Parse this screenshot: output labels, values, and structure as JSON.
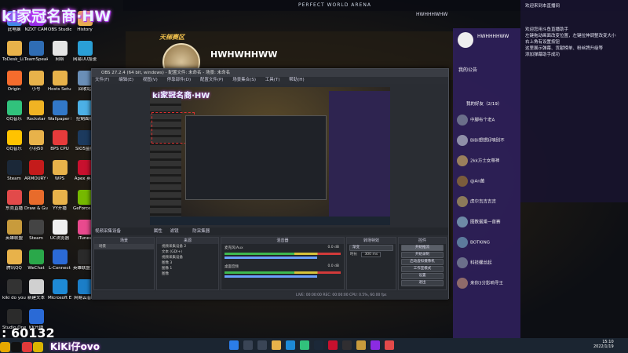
{
  "overlay": {
    "logo": "ki家冠名商·HW",
    "bottom_number": ": 60132",
    "social_handle": "KiKi仔ovo"
  },
  "desktop_icons": [
    {
      "label": "此电脑",
      "color": "#3a8ee6"
    },
    {
      "label": "NZXT CAM",
      "color": "#8b2be2"
    },
    {
      "label": "OBS Studio",
      "color": "#302e31"
    },
    {
      "label": "History",
      "color": "#e8b24a"
    },
    {
      "label": "ToDesk_Li...",
      "color": "#e8b24a"
    },
    {
      "label": "TeamSpeak 3",
      "color": "#2f6db5"
    },
    {
      "label": "网络",
      "color": "#e5e5e5"
    },
    {
      "label": "网易UU加速器",
      "color": "#2a9fd6"
    },
    {
      "label": "Origin",
      "color": "#f56c2d"
    },
    {
      "label": "小号",
      "color": "#e8b24a"
    },
    {
      "label": "Hosts Setup",
      "color": "#e8b24a"
    },
    {
      "label": "回收站",
      "color": "#6a8fb8"
    },
    {
      "label": "QQ音乐",
      "color": "#31c27c"
    },
    {
      "label": "Rockstar",
      "color": "#f0b323"
    },
    {
      "label": "Wallpaper Engine",
      "color": "#3278c8"
    },
    {
      "label": "控制面板",
      "color": "#4cb0e6"
    },
    {
      "label": "QQ音乐",
      "color": "#ffc300"
    },
    {
      "label": "小羽50",
      "color": "#e8b24a"
    },
    {
      "label": "BPS CPU",
      "color": "#e63b3b"
    },
    {
      "label": "SIO5监控",
      "color": "#1c3a5e"
    },
    {
      "label": "Steam",
      "color": "#1b2838"
    },
    {
      "label": "ARMOURY CRATE",
      "color": "#c41b1b"
    },
    {
      "label": "WPS",
      "color": "#e8b24a"
    },
    {
      "label": "Apex 英雄",
      "color": "#c8102e"
    },
    {
      "label": "东莞直播",
      "color": "#e24a4a"
    },
    {
      "label": "Draw & Guess",
      "color": "#e86b2b"
    },
    {
      "label": "YY开播",
      "color": "#e8b24a"
    },
    {
      "label": "GeForce Experience",
      "color": "#76b900"
    },
    {
      "label": "英雄联盟",
      "color": "#c89b3c"
    },
    {
      "label": "Steam",
      "color": "#444"
    },
    {
      "label": "UC浏览器",
      "color": "#f0f0f0"
    },
    {
      "label": "iTunes",
      "color": "#e94a8e"
    },
    {
      "label": "腾讯QQ",
      "color": "#e8b24a"
    },
    {
      "label": "WeChat",
      "color": "#2aa84a"
    },
    {
      "label": "L-Connect",
      "color": "#2b6ad6"
    },
    {
      "label": "英雄联盟大厅",
      "color": "#2a2a2a"
    },
    {
      "label": "kiki do you love me",
      "color": "#333"
    },
    {
      "label": "新建文本",
      "color": "#d0d0d0"
    },
    {
      "label": "Microsoft Edge",
      "color": "#1e8ad6"
    },
    {
      "label": "网易云音乐",
      "color": "#1b7ec8"
    },
    {
      "label": "Studio One 5",
      "color": "#2b2b2b"
    },
    {
      "label": "KK开播",
      "color": "#2a6ad6"
    }
  ],
  "game": {
    "title": "PERFECT WORLD ARENA",
    "user": "HWHHHWHW",
    "channel_name": "HWHWHHWW",
    "channel_logo": "天梯赛区"
  },
  "obs": {
    "title": "OBS 27.2.4 (64 bit, windows) - 配置文件: 未命名 - 场景: 未命名",
    "menu": [
      "文件(F)",
      "编辑(E)",
      "视图(V)",
      "停靠部件(D)",
      "配置文件(P)",
      "场景集合(S)",
      "工具(T)",
      "帮助(H)"
    ],
    "toolbar": {
      "source_label": "视频采集设备",
      "props": "属性",
      "filters": "滤镜",
      "device": "防采集器"
    },
    "docks": {
      "scenes": "场景",
      "sources": "来源",
      "mixer": "混音器",
      "transitions": "转场特效",
      "controls": "控件"
    },
    "scenes": [
      "场景"
    ],
    "sources": [
      "视频采集设备 2",
      "文本 (GDI+)",
      "视频采集设备",
      "图像 3",
      "图像 1",
      "图像"
    ],
    "mixer": [
      {
        "name": "麦克风/Aux",
        "db": "0.0 dB"
      },
      {
        "name": "桌面音频",
        "db": "0.0 dB"
      }
    ],
    "transitions": {
      "type": "渐变",
      "duration_label": "时长",
      "duration": "300 ms"
    },
    "controls": [
      "开始推流",
      "开始录制",
      "启动虚拟摄像机",
      "工作室模式",
      "设置",
      "退出"
    ],
    "status": "LIVE: 00:00:00   REC: 00:00:00   CPU: 0.5%, 60.00 fps"
  },
  "chat": {
    "header": "HWHHHHWW",
    "notice_title": "我的公告",
    "fans_label": "我的好友（2/19）",
    "notice_lines": [
      "欢迎来到本直播间",
      "欢迎您用斗鱼直播助手",
      "左键拖动画面改变位置，左键拉伸调整改变大小",
      "右上角有设置按钮",
      "这里展示弹幕、贡献榜单、粉丝牌升级等",
      "添加弹幕助手成功"
    ],
    "fans": [
      {
        "name": "中脚布个老A",
        "color": "#6b6f8a"
      },
      {
        "name": "BiBi想想好嘀别不",
        "color": "#8f8fa8"
      },
      {
        "name": "2kk方士女尊神",
        "color": "#9a7f5c"
      },
      {
        "name": "@An菌",
        "color": "#7a5c3c"
      },
      {
        "name": "虎尔吉吉吉吉",
        "color": "#8c7a5a"
      },
      {
        "name": "图数据乘一首赛",
        "color": "#6e8aa6"
      },
      {
        "name": "BOTKING",
        "color": "#5c7a9c"
      },
      {
        "name": "科技螺丝起",
        "color": "#6b6f8a"
      },
      {
        "name": "来你3分影响寻王",
        "color": "#8f6a6a"
      }
    ]
  },
  "taskbar": {
    "time": "15:10",
    "date": "2022/1/19"
  }
}
